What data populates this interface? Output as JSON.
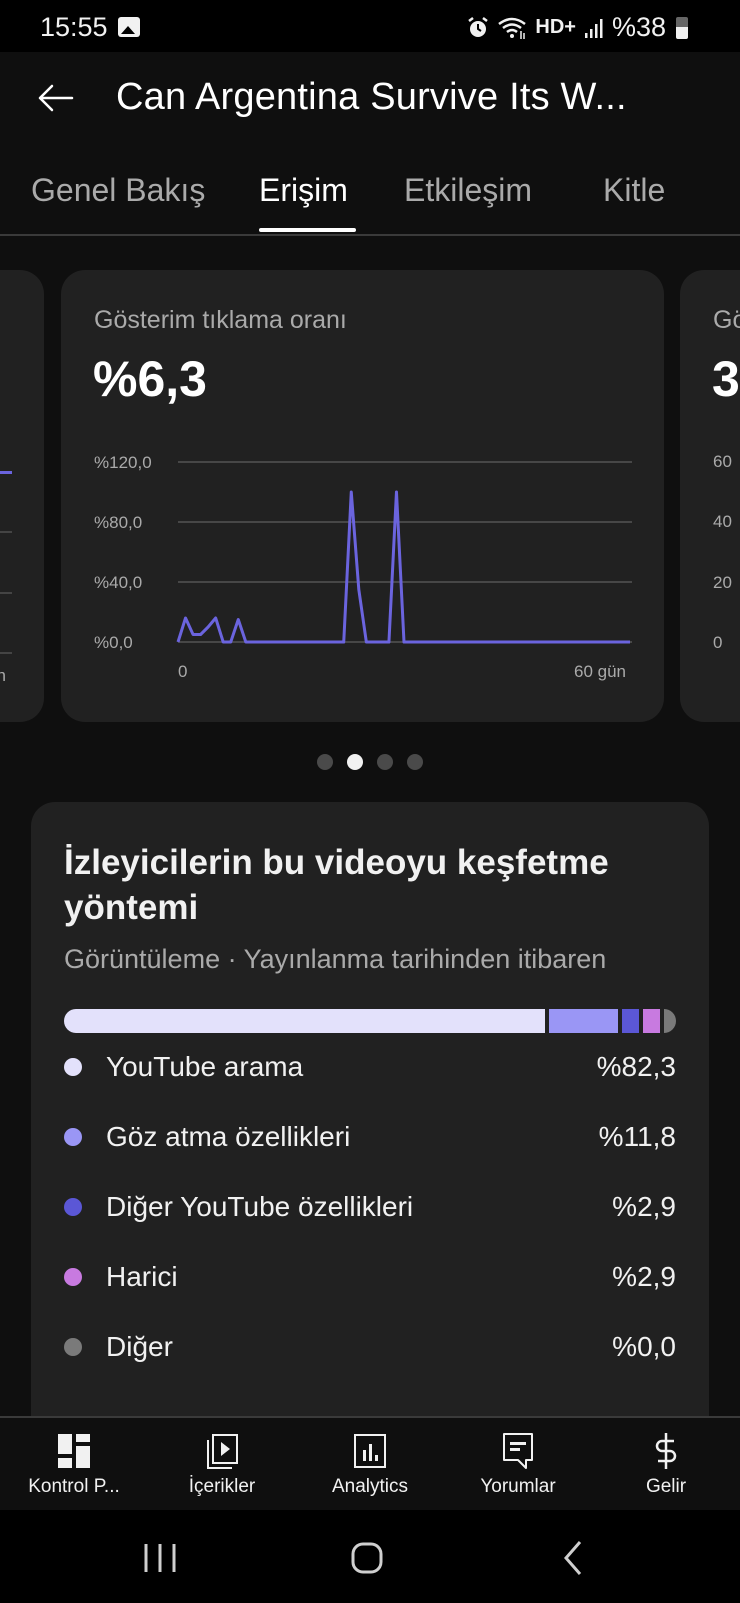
{
  "status_bar": {
    "time": "15:55",
    "battery": "%38",
    "icons": [
      "gallery-icon",
      "alarm-icon",
      "wifi-icon",
      "hd-plus-icon",
      "signal-icon",
      "battery-icon"
    ],
    "hd_label": "HD+"
  },
  "app_bar": {
    "title": "Can Argentina Survive Its W...",
    "back_icon": "arrow-left-icon"
  },
  "tabs": [
    {
      "label": "Genel Bakış",
      "active": false
    },
    {
      "label": "Erişim",
      "active": true
    },
    {
      "label": "Etkileşim",
      "active": false
    },
    {
      "label": "Kitle",
      "active": false
    }
  ],
  "carousel": {
    "current_index": 1,
    "count": 4,
    "main_card": {
      "label": "Gösterim tıklama oranı",
      "value": "%6,3"
    },
    "right_card": {
      "label": "Gö",
      "value": "3",
      "ticks": [
        "60",
        "40",
        "20",
        "0"
      ]
    },
    "left_card": {
      "x_tick_fragment": "n"
    }
  },
  "chart_data": {
    "type": "line",
    "title": "Gösterim tıklama oranı",
    "xlabel": "",
    "ylabel": "",
    "x_range": [
      0,
      60
    ],
    "ylim": [
      0,
      120
    ],
    "y_ticks": [
      "%0,0",
      "%40,0",
      "%80,0",
      "%120,0"
    ],
    "y_tick_values": [
      0,
      40,
      80,
      120
    ],
    "x_ticks": [
      "0",
      "60 gün"
    ],
    "x_tick_values": [
      0,
      60
    ],
    "grid": true,
    "series": [
      {
        "name": "Gösterim tıklama oranı",
        "color": "#6b64de",
        "x": [
          0,
          1,
          2,
          3,
          4,
          5,
          6,
          7,
          8,
          9,
          10,
          15,
          20,
          21,
          22,
          23,
          24,
          25,
          26,
          27,
          28,
          29,
          30,
          35,
          40,
          45,
          50,
          55,
          60
        ],
        "values": [
          0,
          16,
          5,
          5,
          10,
          16,
          0,
          0,
          15,
          0,
          0,
          0,
          0,
          0,
          0,
          100,
          35,
          0,
          0,
          0,
          0,
          100,
          0,
          0,
          0,
          0,
          0,
          0,
          0
        ]
      }
    ]
  },
  "discovery": {
    "title": "İzleyicilerin bu videoyu keşfetme yöntemi",
    "subtitle": "Görüntüleme · Yayınlanma tarihinden itibaren",
    "sources": [
      {
        "label": "YouTube arama",
        "value": "%82,3",
        "percent": 82.3,
        "color": "#e3e1fb"
      },
      {
        "label": "Göz atma özellikleri",
        "value": "%11,8",
        "percent": 11.8,
        "color": "#9a96f5"
      },
      {
        "label": "Diğer YouTube özellikleri",
        "value": "%2,9",
        "percent": 2.9,
        "color": "#5b57d6"
      },
      {
        "label": "Harici",
        "value": "%2,9",
        "percent": 2.9,
        "color": "#c87ae0"
      },
      {
        "label": "Diğer",
        "value": "%0,0",
        "percent": 0.0,
        "color": "#7a7a7a"
      }
    ]
  },
  "bottom_nav": [
    {
      "label": "Kontrol P...",
      "icon": "dashboard-icon"
    },
    {
      "label": "İçerikler",
      "icon": "content-icon"
    },
    {
      "label": "Analytics",
      "icon": "analytics-icon"
    },
    {
      "label": "Yorumlar",
      "icon": "comments-icon"
    },
    {
      "label": "Gelir",
      "icon": "dollar-icon"
    }
  ],
  "system_nav": [
    "recents-icon",
    "home-icon",
    "back-icon"
  ]
}
